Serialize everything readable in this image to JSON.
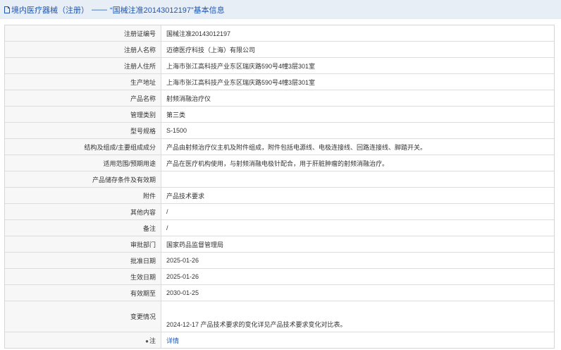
{
  "header": {
    "section": "境内医疗器械（注册）",
    "separator": "——",
    "title": "“国械注准20143012197”基本信息"
  },
  "rows": [
    {
      "label": "注册证编号",
      "value": "国械注准20143012197"
    },
    {
      "label": "注册人名称",
      "value": "迈德医疗科技（上海）有限公司"
    },
    {
      "label": "注册人住所",
      "value": "上海市张江高科技产业东区瑞庆路590号4幢3层301室"
    },
    {
      "label": "生产地址",
      "value": "上海市张江高科技产业东区瑞庆路590号4幢3层301室"
    },
    {
      "label": "产品名称",
      "value": "射频消融治疗仪"
    },
    {
      "label": "管理类别",
      "value": "第三类"
    },
    {
      "label": "型号规格",
      "value": "S-1500"
    },
    {
      "label": "结构及组成/主要组成成分",
      "value": "产品由射频治疗仪主机及附件组成，附件包括电源线、电极连接线、回路连接线、脚踏开关。"
    },
    {
      "label": "适用范围/预期用途",
      "value": "产品在医疗机构使用，与射频消融电极针配合，用于肝脏肿瘤的射频消融治疗。"
    },
    {
      "label": "产品储存条件及有效期",
      "value": ""
    },
    {
      "label": "附件",
      "value": "产品技术要求"
    },
    {
      "label": "其他内容",
      "value": "/"
    },
    {
      "label": "备注",
      "value": "/"
    },
    {
      "label": "审批部门",
      "value": "国家药品监督管理局"
    },
    {
      "label": "批准日期",
      "value": "2025-01-26"
    },
    {
      "label": "生效日期",
      "value": "2025-01-26"
    },
    {
      "label": "有效期至",
      "value": "2030-01-25"
    },
    {
      "label": "变更情况",
      "value": "2024-12-17 产品技术要求的变化详见产品技术要求变化对比表。"
    }
  ],
  "note": {
    "label": "注",
    "link": "详情"
  }
}
